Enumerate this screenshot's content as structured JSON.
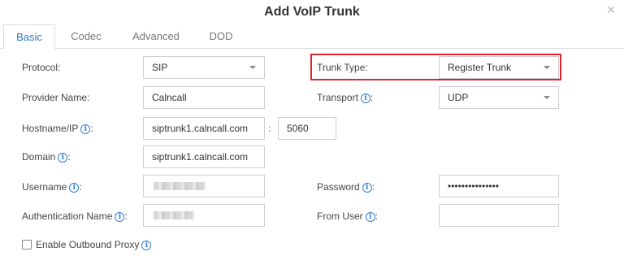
{
  "dialog": {
    "title": "Add VoIP Trunk",
    "close_icon": "close-icon"
  },
  "tabs": [
    {
      "label": "Basic",
      "active": true
    },
    {
      "label": "Codec",
      "active": false
    },
    {
      "label": "Advanced",
      "active": false
    },
    {
      "label": "DOD",
      "active": false
    }
  ],
  "form": {
    "protocol_label": "Protocol:",
    "protocol_value": "SIP",
    "trunk_type_label": "Trunk Type:",
    "trunk_type_value": "Register Trunk",
    "provider_name_label": "Provider Name:",
    "provider_name_value": "Calncall",
    "transport_label": "Transport",
    "transport_value": "UDP",
    "hostname_label": "Hostname/IP",
    "hostname_value": "siptrunk1.calncall.com",
    "hostname_separator": ":",
    "port_value": "5060",
    "domain_label": "Domain",
    "domain_value": "siptrunk1.calncall.com",
    "username_label": "Username",
    "password_label": "Password",
    "password_value": "•••••••••••••••",
    "auth_name_label": "Authentication Name",
    "from_user_label": "From User",
    "outbound_proxy_label": "Enable Outbound Proxy",
    "field_suffix": ":",
    "info_glyph": "i"
  },
  "colors": {
    "accent": "#2a78c6",
    "info": "#2f7ed8",
    "highlight": "#d9262c"
  }
}
